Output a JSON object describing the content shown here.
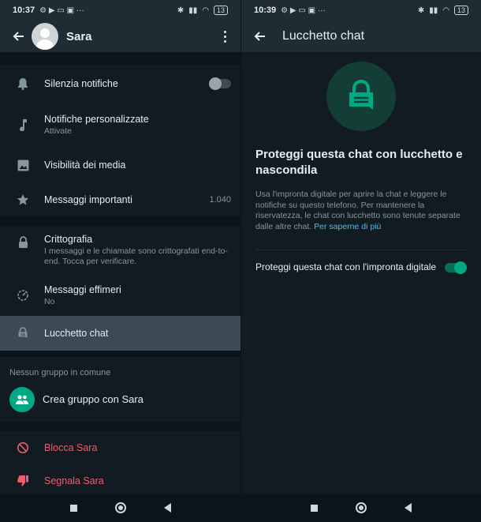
{
  "left": {
    "status": {
      "time": "10:37",
      "battery": "13"
    },
    "contact_name": "Sara",
    "rows": [
      {
        "label": "Silenzia notifiche"
      },
      {
        "label": "Notifiche personalizzate",
        "sub": "Attivate"
      },
      {
        "label": "Visibilità dei media"
      },
      {
        "label": "Messaggi importanti",
        "value": "1.040"
      },
      {
        "label": "Crittografia",
        "sub": "I messaggi e le chiamate sono crittografati end-to-end. Tocca per verificare."
      },
      {
        "label": "Messaggi effimeri",
        "sub": "No"
      },
      {
        "label": "Lucchetto chat"
      }
    ],
    "groups_label": "Nessun gruppo in comune",
    "create_group": "Crea gruppo con Sara",
    "block": "Blocca Sara",
    "report": "Segnala Sara"
  },
  "right": {
    "status": {
      "time": "10:39",
      "battery": "13"
    },
    "title": "Lucchetto chat",
    "heading": "Proteggi questa chat con lucchetto e nascondila",
    "description": "Usa l'impronta digitale per aprire la chat e leggere le notifiche su questo telefono. Per mantenere la riservatezza, le chat con lucchetto sono tenute separate dalle altre chat.",
    "learn_more": "Per saperne di più",
    "toggle_label": "Proteggi questa chat con l'impronta digitale",
    "toggle_on": true
  },
  "colors": {
    "accent": "#00a884",
    "danger": "#f15c6d",
    "link": "#53bdeb",
    "background": "#111b21"
  },
  "icons": [
    "back-arrow-icon",
    "bell-icon",
    "music-note-icon",
    "image-icon",
    "star-icon",
    "lock-icon",
    "timer-icon",
    "chat-lock-icon",
    "group-icon",
    "block-icon",
    "thumbs-down-icon",
    "more-vert-icon"
  ]
}
